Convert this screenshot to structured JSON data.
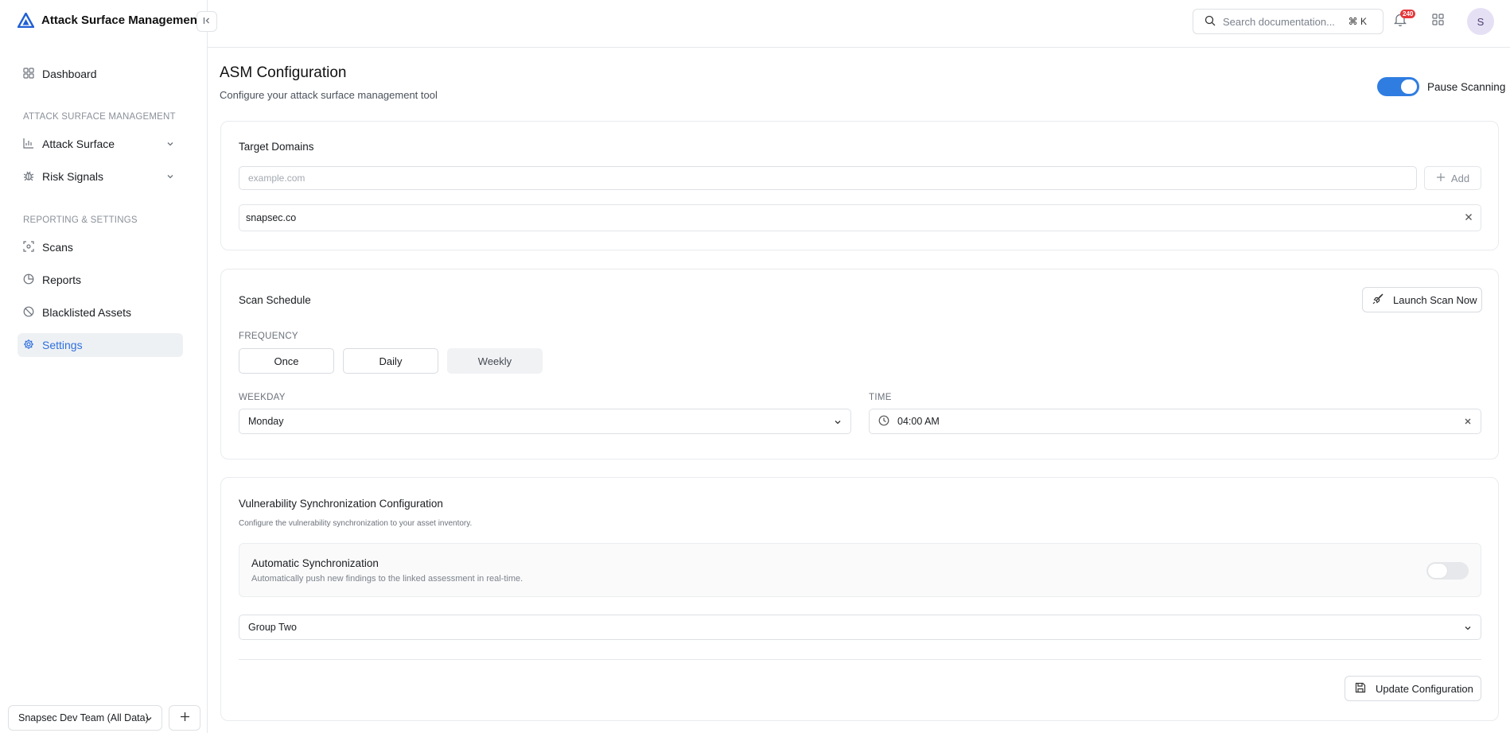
{
  "app": {
    "title": "Attack Surface Management"
  },
  "sidebar": {
    "dashboard": "Dashboard",
    "section_asm": "ATTACK SURFACE MANAGEMENT",
    "attack_surface": "Attack Surface",
    "risk_signals": "Risk Signals",
    "section_reporting": "REPORTING & SETTINGS",
    "scans": "Scans",
    "reports": "Reports",
    "blacklisted": "Blacklisted Assets",
    "settings": "Settings",
    "active_item": "Settings",
    "team": "Snapsec Dev Team (All Data)"
  },
  "topbar": {
    "search_placeholder": "Search documentation...",
    "shortcut": "⌘ K",
    "notification_count": "240",
    "avatar_initial": "S"
  },
  "page": {
    "title": "ASM Configuration",
    "subtitle": "Configure your attack surface management tool",
    "pause_label": "Pause Scanning",
    "pause_enabled": true
  },
  "target_domains": {
    "title": "Target Domains",
    "input_placeholder": "example.com",
    "add_label": "Add",
    "domains": [
      "snapsec.co"
    ]
  },
  "scan_schedule": {
    "title": "Scan Schedule",
    "launch_label": "Launch Scan Now",
    "frequency_label": "FREQUENCY",
    "frequency_options": [
      "Once",
      "Daily",
      "Weekly"
    ],
    "frequency_selected": "Weekly",
    "weekday_label": "WEEKDAY",
    "weekday_value": "Monday",
    "time_label": "TIME",
    "time_value": "04:00 AM"
  },
  "vuln_sync": {
    "title": "Vulnerability Synchronization Configuration",
    "subtitle": "Configure the vulnerability synchronization to your asset inventory.",
    "auto_title": "Automatic Synchronization",
    "auto_subtitle": "Automatically push new findings to the linked assessment in real-time.",
    "auto_enabled": false,
    "group_value": "Group Two",
    "update_label": "Update Configuration"
  },
  "colors": {
    "accent": "#2f7de1",
    "badge": "#e5383b",
    "active_nav_bg": "#eef1f4"
  }
}
